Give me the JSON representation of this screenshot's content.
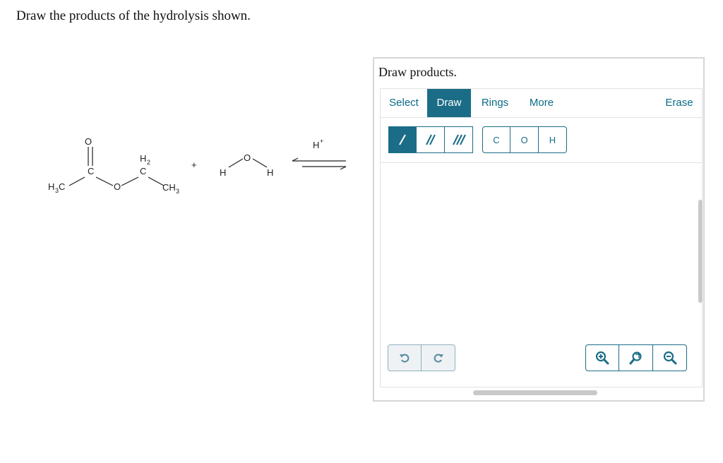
{
  "prompt": "Draw the products of the hydrolysis shown.",
  "reaction": {
    "ester_labels": {
      "o_top": "O",
      "c_carbonyl": "C",
      "h3c": "H",
      "h3c_sub": "3",
      "h3c_c": "C",
      "o_ester": "O",
      "h2": "H",
      "h2_sub": "2",
      "ch2_c": "C",
      "ch3": "CH",
      "ch3_sub": "3"
    },
    "plus": "+",
    "water_labels": {
      "h_left": "H",
      "o": "O",
      "h_right": "H"
    },
    "catalyst": "H",
    "catalyst_sup": "+"
  },
  "panel": {
    "title": "Draw products.",
    "tabs": [
      "Select",
      "Draw",
      "Rings",
      "More",
      "Erase"
    ],
    "active_tab": "Draw",
    "bond_tools": [
      "single-bond",
      "double-bond",
      "triple-bond"
    ],
    "atoms": [
      "C",
      "O",
      "H"
    ],
    "accent": "#1b6d87"
  }
}
